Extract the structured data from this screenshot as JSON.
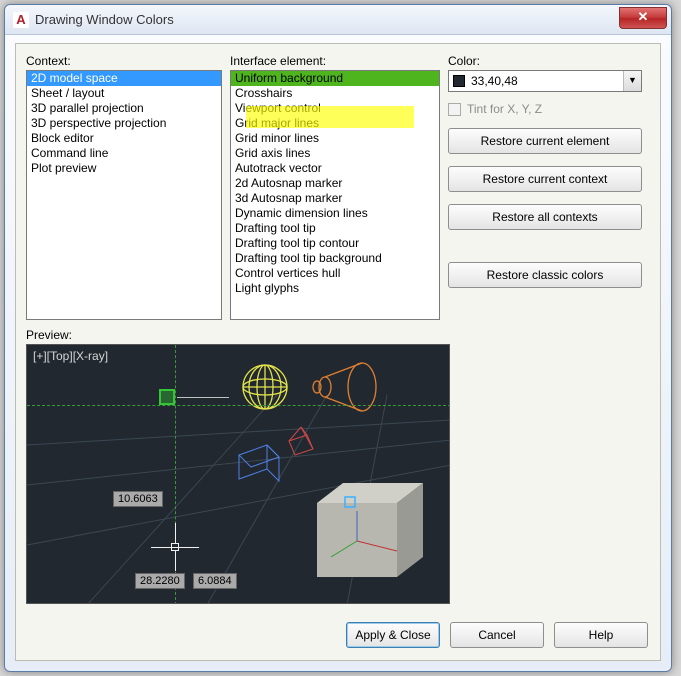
{
  "window": {
    "title": "Drawing Window Colors"
  },
  "labels": {
    "context": "Context:",
    "interface": "Interface element:",
    "color": "Color:",
    "tint": "Tint for X, Y, Z",
    "preview": "Preview:"
  },
  "context_items": [
    "2D model space",
    "Sheet / layout",
    "3D parallel projection",
    "3D perspective projection",
    "Block editor",
    "Command line",
    "Plot preview"
  ],
  "context_selected": 0,
  "interface_items": [
    "Uniform background",
    "Crosshairs",
    "Viewport control",
    "Grid major lines",
    "Grid minor lines",
    "Grid axis lines",
    "Autotrack vector",
    "2d Autosnap marker",
    "3d Autosnap marker",
    "Dynamic dimension lines",
    "Drafting tool tip",
    "Drafting tool tip contour",
    "Drafting tool tip background",
    "Control vertices hull",
    "Light glyphs"
  ],
  "interface_selected": 0,
  "color_value": "33,40,48",
  "color_hex": "#212830",
  "buttons": {
    "restore_element": "Restore current element",
    "restore_context": "Restore current context",
    "restore_all": "Restore all contexts",
    "restore_classic": "Restore classic colors",
    "apply": "Apply & Close",
    "cancel": "Cancel",
    "help": "Help"
  },
  "preview": {
    "viewport_label": "[+][Top][X-ray]",
    "dim1": "10.6063",
    "dim2": "28.2280",
    "dim3": "6.0884"
  }
}
